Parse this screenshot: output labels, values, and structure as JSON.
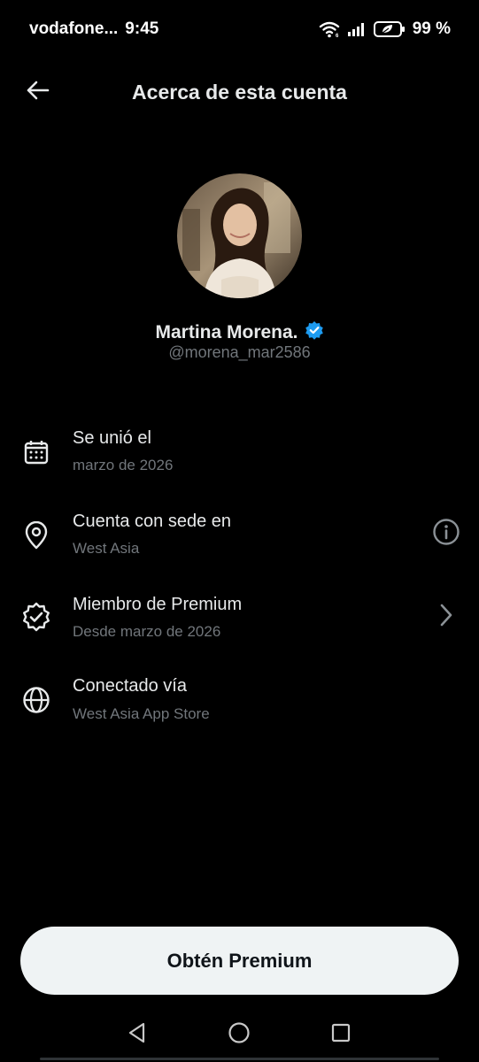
{
  "status_bar": {
    "carrier": "vodafone...",
    "time": "9:45",
    "battery": "99 %"
  },
  "header": {
    "title": "Acerca de esta cuenta"
  },
  "profile": {
    "name": "Martina Morena.",
    "handle": "@morena_mar2586",
    "verified_color": "#1d9bf0"
  },
  "info_items": [
    {
      "icon": "calendar-icon",
      "title": "Se unió el",
      "subtitle": "marzo de 2026"
    },
    {
      "icon": "location-pin-icon",
      "title": "Cuenta con sede en",
      "subtitle": "West Asia",
      "trailing": "info-icon"
    },
    {
      "icon": "verified-badge-icon",
      "title": "Miembro de Premium",
      "subtitle": "Desde marzo de 2026",
      "trailing": "chevron-right-icon"
    },
    {
      "icon": "globe-icon",
      "title": "Conectado vía",
      "subtitle": "West Asia App Store"
    }
  ],
  "cta": {
    "label": "Obtén Premium"
  },
  "colors": {
    "background": "#000000",
    "primary_text": "#e7e9ea",
    "secondary_text": "#71767b",
    "button_bg": "#eff3f4"
  }
}
